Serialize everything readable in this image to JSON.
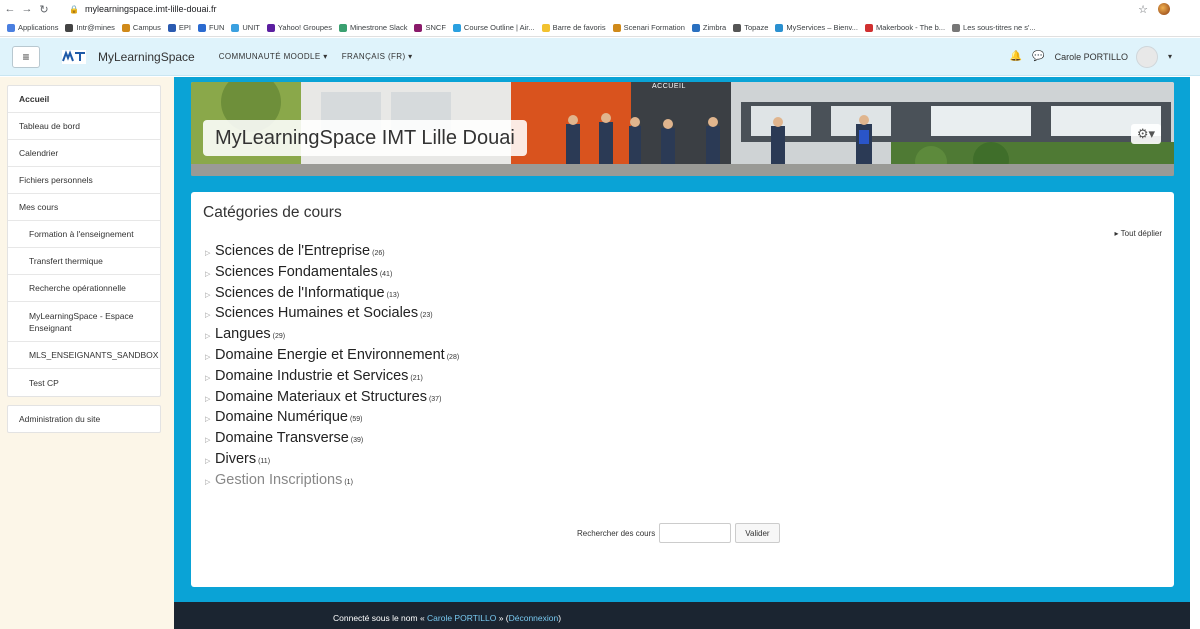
{
  "browser": {
    "url": "mylearningspace.imt-lille-douai.fr",
    "bookmarks": [
      {
        "label": "Applications",
        "color": "#4a7fe0"
      },
      {
        "label": "Intr@mines",
        "color": "#444444"
      },
      {
        "label": "Campus",
        "color": "#d08a1a"
      },
      {
        "label": "EPI",
        "color": "#2a5ab0"
      },
      {
        "label": "FUN",
        "color": "#2a6ad0"
      },
      {
        "label": "UNIT",
        "color": "#3aa0e0"
      },
      {
        "label": "Yahoo! Groupes",
        "color": "#5b1fa0"
      },
      {
        "label": "Minestrone Slack",
        "color": "#3aa070"
      },
      {
        "label": "SNCF",
        "color": "#8a1a6a"
      },
      {
        "label": "Course Outline | Air...",
        "color": "#2aa0e0"
      },
      {
        "label": "Barre de favoris",
        "color": "#f2c230"
      },
      {
        "label": "Scenari Formation",
        "color": "#d08a1a"
      },
      {
        "label": "Zimbra",
        "color": "#2a70c0"
      },
      {
        "label": "Topaze",
        "color": "#555555"
      },
      {
        "label": "MyServices – Bienv...",
        "color": "#2a90d0"
      },
      {
        "label": "Makerbook - The b...",
        "color": "#d03030"
      },
      {
        "label": "Les sous-titres ne s'...",
        "color": "#777777"
      }
    ]
  },
  "navbar": {
    "site_name": "MyLearningSpace",
    "menu_community": "COMMUNAUTÉ MOODLE ▾",
    "menu_language": "FRANÇAIS (FR) ▾",
    "user_name": "Carole PORTILLO"
  },
  "drawer": {
    "main_items": [
      {
        "label": "Accueil"
      },
      {
        "label": "Tableau de bord"
      },
      {
        "label": "Calendrier"
      },
      {
        "label": "Fichiers personnels"
      },
      {
        "label": "Mes cours"
      },
      {
        "label": "Formation à l'enseignement"
      },
      {
        "label": "Transfert thermique"
      },
      {
        "label": "Recherche opérationnelle"
      },
      {
        "label": "MyLearningSpace - Espace Enseignant"
      },
      {
        "label": "MLS_ENSEIGNANTS_SANDBOX"
      },
      {
        "label": "Test CP"
      }
    ],
    "admin_item": "Administration du site"
  },
  "header": {
    "title": "MyLearningSpace IMT Lille Douai",
    "tab_label": "ACCUEIL"
  },
  "main": {
    "section_title": "Catégories de cours",
    "expand_all": "Tout déplier",
    "categories": [
      {
        "name": "Sciences de l'Entreprise",
        "count": "(26)"
      },
      {
        "name": "Sciences Fondamentales",
        "count": "(41)"
      },
      {
        "name": "Sciences de l'Informatique",
        "count": "(13)"
      },
      {
        "name": "Sciences Humaines et Sociales",
        "count": "(23)"
      },
      {
        "name": "Langues",
        "count": "(29)"
      },
      {
        "name": "Domaine Energie et Environnement",
        "count": "(28)"
      },
      {
        "name": "Domaine Industrie et Services",
        "count": "(21)"
      },
      {
        "name": "Domaine Materiaux et Structures",
        "count": "(37)"
      },
      {
        "name": "Domaine Numérique",
        "count": "(59)"
      },
      {
        "name": "Domaine Transverse",
        "count": "(39)"
      },
      {
        "name": "Divers",
        "count": "(11)"
      },
      {
        "name": "Gestion Inscriptions",
        "count": "(1)"
      }
    ],
    "search_label": "Rechercher des cours",
    "search_button": "Valider"
  },
  "footer": {
    "prefix": "Connecté sous le nom « ",
    "user": "Carole PORTILLO",
    "middle": " » (",
    "logout": "Déconnexion",
    "suffix": ")"
  },
  "colors": {
    "accent": "#0aa3d6",
    "navbar_bg": "#dff3fb",
    "drawer_bg": "#fcf6e8",
    "footer_bg": "#1b2531"
  }
}
